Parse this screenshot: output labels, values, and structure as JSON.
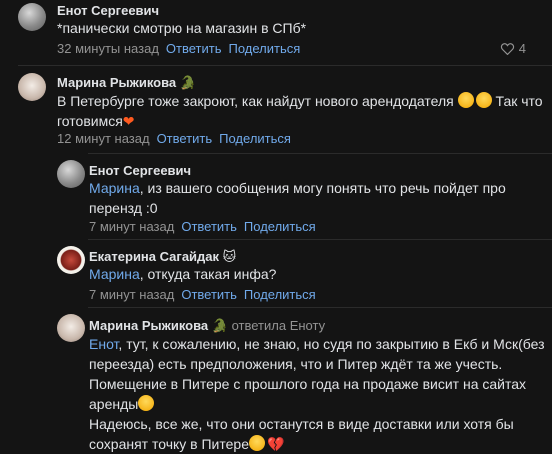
{
  "comments": [
    {
      "author": "Енот Сергеевич",
      "lines": [
        "*панически смотрю на магазин в СПб*"
      ],
      "time": "32 минуты назад",
      "reply": "Ответить",
      "share": "Поделиться",
      "likes": "4"
    },
    {
      "author": "Марина Рыжикова",
      "badge": "🐊",
      "line1": "В Петербурге тоже закроют, как найдут нового арендодателя",
      "line1_end": "Так что",
      "line2": "готовимся",
      "time": "12 минут назад",
      "reply": "Ответить",
      "share": "Поделиться"
    },
    {
      "author": "Енот Сергеевич",
      "mention": "Марина",
      "line1": ", из вашего сообщения могу понять что речь пойдет про",
      "line2": "перензд :0",
      "time": "7 минут назад",
      "reply": "Ответить",
      "share": "Поделиться"
    },
    {
      "author": "Екатерина Сагайдак",
      "badge": "🐱",
      "mention": "Марина",
      "line1": ", откуда такая инфа?",
      "time": "7 минут назад",
      "reply": "Ответить",
      "share": "Поделиться"
    },
    {
      "author": "Марина Рыжикова",
      "badge": "🐊",
      "replied_to": "ответила Еноту",
      "mention": "Енот",
      "line1": ", тут, к сожалению, не знаю, но судя по закрытию в Екб и Мск(без",
      "line2": "переезда) есть предположения, что и Питер ждёт та же учесть.",
      "line3": "Помещение в Питере с прошлого года на продаже висит на сайтах",
      "line4": "аренды",
      "line5": "Надеюсь, все же, что они останутся в виде доставки или хотя бы",
      "line6": "сохранят точку в Питере"
    }
  ]
}
